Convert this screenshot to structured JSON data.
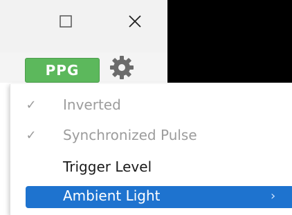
{
  "window": {
    "maximize_icon": "square-outline-icon",
    "close_icon": "x-close-icon"
  },
  "toolbar": {
    "ppg_label": "PPG",
    "settings_icon": "gear-icon",
    "accent_color": "#5cb85c"
  },
  "menu": {
    "items": [
      {
        "label": "Inverted",
        "checked": true,
        "enabled": false,
        "check_icon": "checkmark-icon"
      },
      {
        "label": "Synchronized Pulse",
        "checked": true,
        "enabled": false,
        "check_icon": "checkmark-icon"
      },
      {
        "label": "Trigger Level",
        "checked": false,
        "enabled": true
      },
      {
        "label": "Ambient Light",
        "checked": false,
        "enabled": true,
        "highlighted": true,
        "submenu_icon": "chevron-right-icon"
      }
    ],
    "highlight_color": "#1e73cf"
  }
}
